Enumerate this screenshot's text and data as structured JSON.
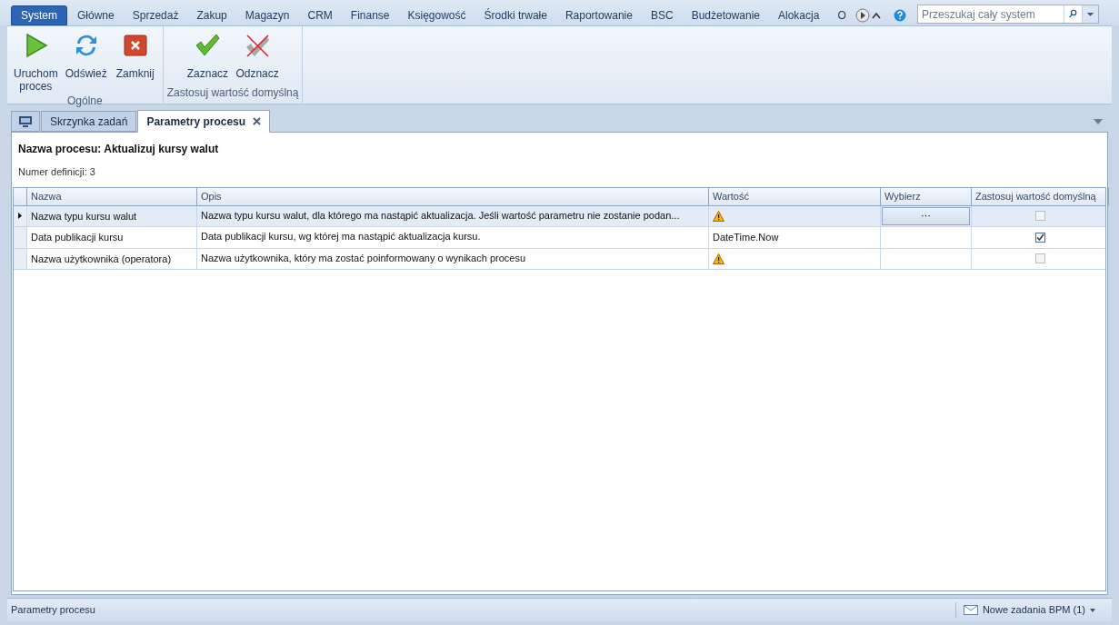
{
  "menu_tabs": [
    {
      "label": "System",
      "selected": true
    },
    {
      "label": "Główne",
      "selected": false
    },
    {
      "label": "Sprzedaż",
      "selected": false
    },
    {
      "label": "Zakup",
      "selected": false
    },
    {
      "label": "Magazyn",
      "selected": false
    },
    {
      "label": "CRM",
      "selected": false
    },
    {
      "label": "Finanse",
      "selected": false
    },
    {
      "label": "Księgowość",
      "selected": false
    },
    {
      "label": "Środki trwałe",
      "selected": false
    },
    {
      "label": "Raportowanie",
      "selected": false
    },
    {
      "label": "BSC",
      "selected": false
    },
    {
      "label": "Budżetowanie",
      "selected": false
    },
    {
      "label": "Alokacja",
      "selected": false
    },
    {
      "label": "O",
      "selected": false
    }
  ],
  "search": {
    "placeholder": "Przeszukaj cały system"
  },
  "ribbon_groups": [
    {
      "label": "Ogólne",
      "buttons": [
        {
          "label": "Uruchom proces",
          "kind": "play"
        },
        {
          "label": "Odśwież",
          "kind": "refresh"
        },
        {
          "label": "Zamknij",
          "kind": "close"
        }
      ]
    },
    {
      "label": "Zastosuj wartość domyślną",
      "buttons": [
        {
          "label": "Zaznacz",
          "kind": "check"
        },
        {
          "label": "Odznacz",
          "kind": "uncheck"
        }
      ]
    }
  ],
  "doc_tabs": [
    {
      "label": "Skrzynka zadań",
      "selected": false,
      "closable": false
    },
    {
      "label": "Parametry procesu",
      "selected": true,
      "closable": true
    }
  ],
  "process_title": "Nazwa procesu: Aktualizuj kursy walut",
  "definition_number": "Numer definicji: 3",
  "table": {
    "columns": [
      "Nazwa",
      "Opis",
      "Wartość",
      "Wybierz",
      "Zastosuj wartość domyślną"
    ],
    "rows": [
      {
        "selected": true,
        "name": "Nazwa typu kursu walut",
        "description": "Nazwa typu kursu walut, dla którego ma nastąpić aktualizacja. Jeśli wartość parametru nie zostanie podan...",
        "value_warning": true,
        "choose": "···",
        "default_applied": false
      },
      {
        "selected": false,
        "name": "Data publikacji kursu",
        "description": "Data publikacji kursu, wg której ma nastąpić aktualizacja kursu.",
        "value": "DateTime.Now",
        "value_warning": false,
        "default_applied": true
      },
      {
        "selected": false,
        "name": "Nazwa użytkownika (operatora)",
        "description": "Nazwa użytkownika, który ma zostać poinformowany o wynikach procesu",
        "value_warning": true,
        "default_applied": false
      }
    ]
  },
  "status_bar": {
    "left": "Parametry procesu",
    "notification": "Nowe zadania BPM (1)"
  }
}
